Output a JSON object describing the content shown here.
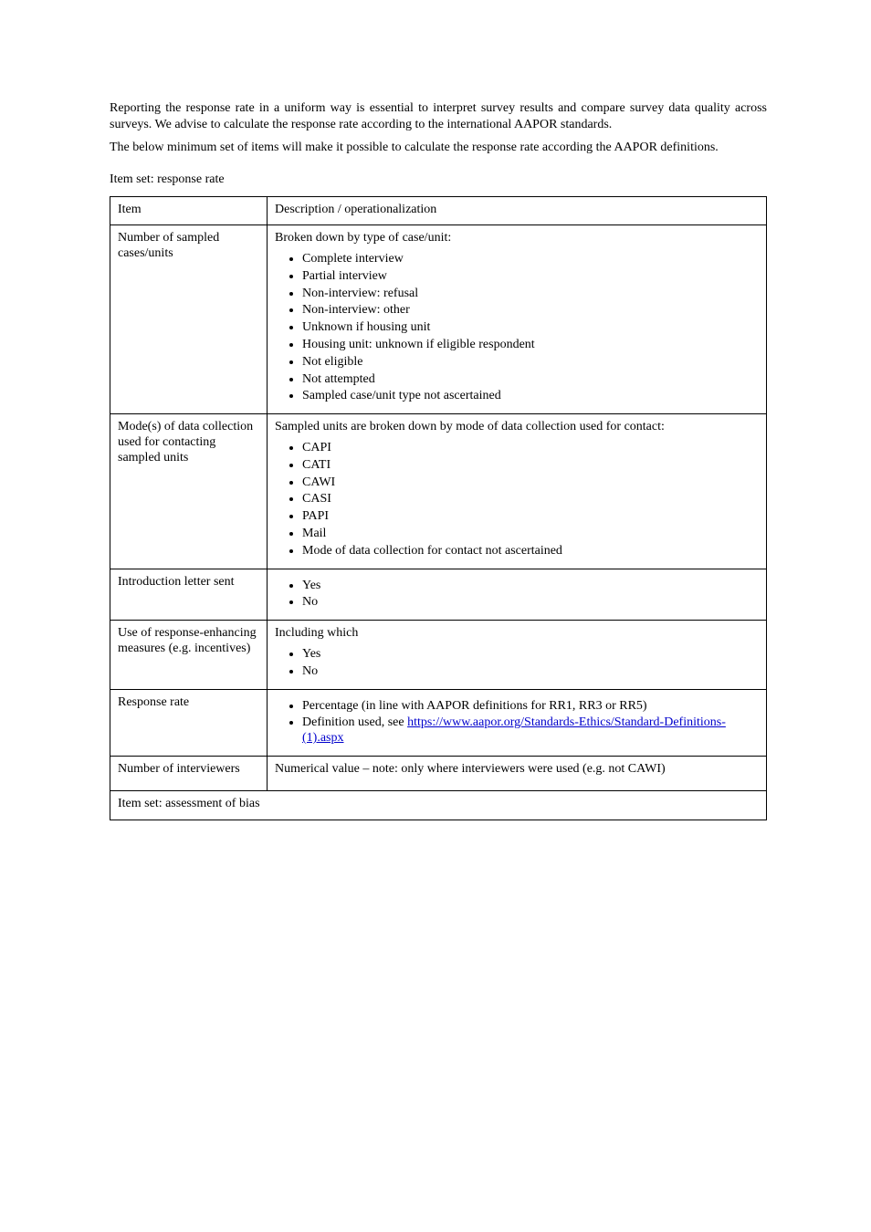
{
  "intro": {
    "p1": "Reporting the response rate in a uniform way is essential to interpret survey results and compare survey data quality across surveys. We advise to calculate the response rate according to the international AAPOR standards.",
    "p2": "The below minimum set of items will make it possible to calculate the response rate according the AAPOR definitions."
  },
  "subhead": "Item set: response rate",
  "table": {
    "headers": {
      "col1": "Item",
      "col2": "Description / operationalization"
    },
    "rows": [
      {
        "label": "Number of sampled cases/units",
        "lead": "Broken down by type of case/unit:",
        "bullets": [
          "Complete interview",
          "Partial interview",
          "Non-interview: refusal",
          "Non-interview: other",
          "Unknown if housing unit",
          "Housing unit: unknown if eligible respondent",
          "Not eligible",
          "Not attempted",
          "Sampled case/unit type not ascertained"
        ]
      },
      {
        "label": "Mode(s) of data collection used for contacting sampled units",
        "lead": "Sampled units are broken down by mode of data collection used for contact:",
        "bullets": [
          "CAPI",
          "CATI",
          "CAWI",
          "CASI",
          "PAPI",
          "Mail",
          "Mode of data collection for contact not ascertained"
        ]
      },
      {
        "label": "Introduction letter sent",
        "bullets": [
          "Yes",
          "No"
        ]
      },
      {
        "label": "Use of response-enhancing measures (e.g. incentives)",
        "lead": "Including which",
        "bullets": [
          "Yes",
          "No"
        ]
      },
      {
        "label": "Response rate",
        "bullets": [
          {
            "text": "Percentage (in line with AAPOR definitions for RR1, RR3 or RR5)"
          },
          {
            "prefix": "Definition used, see ",
            "link_text": "https://www.aapor.org/Standards-Ethics/Standard-Definitions-(1).aspx",
            "link_href": "https://www.aapor.org/Standards-Ethics/Standard-Definitions-(1).aspx"
          }
        ]
      },
      {
        "label": "Number of interviewers",
        "lead": "Numerical value – note: only where interviewers were used (e.g. not CAWI)"
      }
    ],
    "footer": "Item set: assessment of bias"
  }
}
